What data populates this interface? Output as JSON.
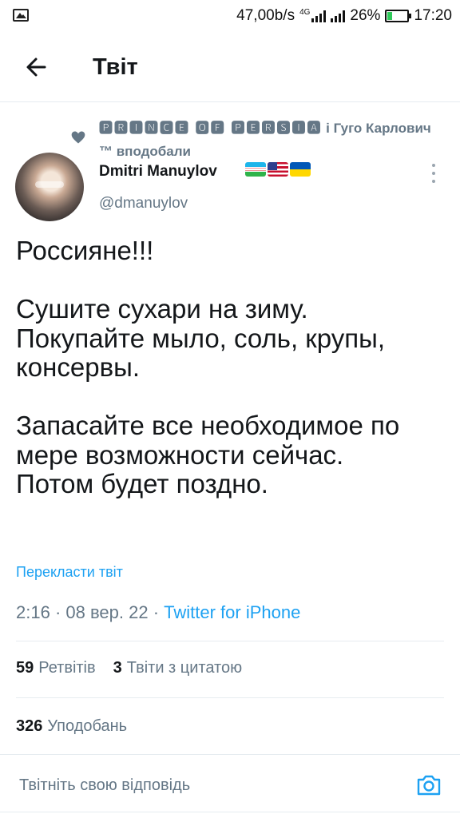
{
  "status_bar": {
    "speed": "47,00b/s",
    "network": "4G",
    "battery_percent": "26%",
    "battery_level": 0.26,
    "time": "17:20",
    "accent_battery": "#2fc95a"
  },
  "header": {
    "title": "Твіт"
  },
  "liked_by": {
    "name1": "🅿🆁🅸🅽🅲🅴 🅾🅵 🅿🅴🆁🆂🅸🅰",
    "rest": " і Гуго Карлович ™ вподобали"
  },
  "author": {
    "name": "Dmitri Manuylov",
    "handle": "@dmanuylov",
    "flags": [
      "uzbekistan-flag",
      "usa-flag",
      "ukraine-flag"
    ]
  },
  "tweet": {
    "paragraphs": [
      [
        "Россияне!!!"
      ],
      [
        "Сушите сухари на зиму.",
        "Покупайте мыло, соль, крупы,",
        "консервы."
      ],
      [
        "Запасайте все необходимое по",
        "мере возможности сейчас.",
        "Потом будет поздно."
      ]
    ],
    "translate_label": "Перекласти твіт",
    "time": "2:16",
    "date": "08 вер. 22",
    "source": "Twitter for iPhone"
  },
  "stats": {
    "retweets_count": "59",
    "retweets_label": "Ретвітів",
    "quotes_count": "3",
    "quotes_label": "Твіти з цитатою",
    "likes_count": "326",
    "likes_label": "Уподобань"
  },
  "reply": {
    "placeholder": "Твітніть свою відповідь"
  },
  "colors": {
    "accent": "#1da1f2",
    "secondary_text": "#657786",
    "primary_text": "#14171a"
  }
}
